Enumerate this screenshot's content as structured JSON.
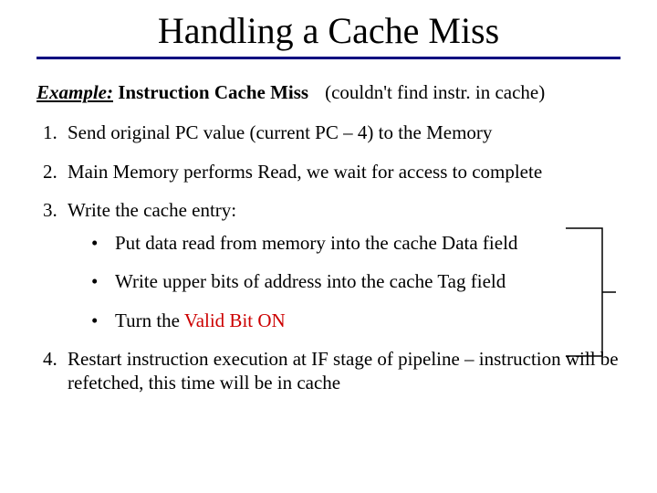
{
  "title": "Handling a Cache Miss",
  "example": {
    "label": "Example:",
    "bold": " Instruction Cache Miss",
    "note": "(couldn't find instr. in cache)"
  },
  "steps": {
    "s1": "Send original PC value (current PC – 4) to the Memory",
    "s2": "Main Memory performs Read, we wait for access to complete",
    "s3": "Write the cache entry:",
    "s3a": "Put data read from memory into the cache Data field",
    "s3b": "Write upper bits of address into the cache Tag field",
    "s3c_pre": "Turn the ",
    "s3c_red": "Valid Bit ON",
    "s4": "Restart instruction execution at IF stage of pipeline – instruction will be refetched, this time will be in cache"
  }
}
